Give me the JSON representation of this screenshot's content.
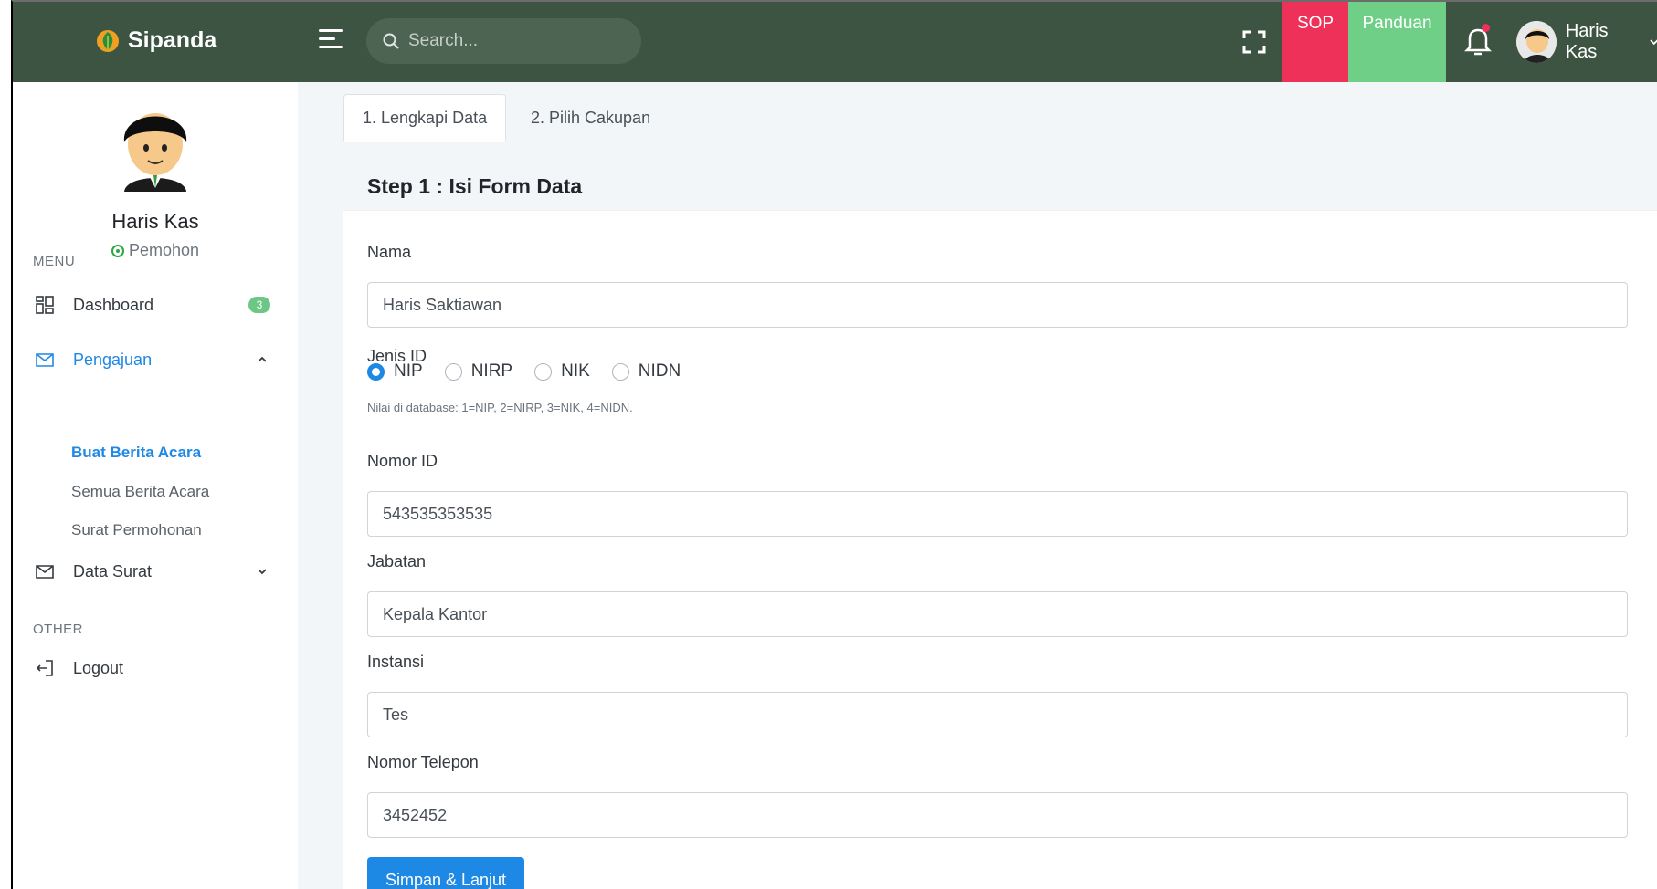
{
  "brand": {
    "name": "Sipanda"
  },
  "search": {
    "placeholder": "Search..."
  },
  "topbar": {
    "sop_label": "SOP",
    "panduan_label": "Panduan",
    "user_name": "Haris Kas"
  },
  "sidebar": {
    "user_name": "Haris Kas",
    "user_role": "Pemohon",
    "menu_heading": "MENU",
    "other_heading": "OTHER",
    "dashboard": {
      "label": "Dashboard",
      "badge": "3"
    },
    "pengajuan": {
      "label": "Pengajuan",
      "subitems": [
        "Buat Berita Acara",
        "Semua Berita Acara",
        "Surat Permohonan"
      ]
    },
    "data_surat": {
      "label": "Data Surat"
    },
    "logout": {
      "label": "Logout"
    }
  },
  "tabs": [
    "1. Lengkapi Data",
    "2. Pilih Cakupan"
  ],
  "card": {
    "title": "Step 1 : Isi Form Data"
  },
  "form": {
    "nama": {
      "label": "Nama",
      "value": "Haris Saktiawan"
    },
    "jenis_id": {
      "label": "Jenis ID",
      "options": [
        "NIP",
        "NIRP",
        "NIK",
        "NIDN"
      ],
      "selected": "NIP",
      "hint": "Nilai di database: 1=NIP, 2=NIRP, 3=NIK, 4=NIDN."
    },
    "nomor_id": {
      "label": "Nomor ID",
      "value": "543535353535"
    },
    "jabatan": {
      "label": "Jabatan",
      "value": "Kepala Kantor"
    },
    "instansi": {
      "label": "Instansi",
      "value": "Tes"
    },
    "nomor_telepon": {
      "label": "Nomor Telepon",
      "value": "3452452"
    },
    "submit_label": "Simpan & Lanjut"
  },
  "colors": {
    "topbar": "#3d5442",
    "sop": "#ee3158",
    "panduan": "#70cf86",
    "primary": "#1e88e5",
    "badge": "#6cc785"
  }
}
